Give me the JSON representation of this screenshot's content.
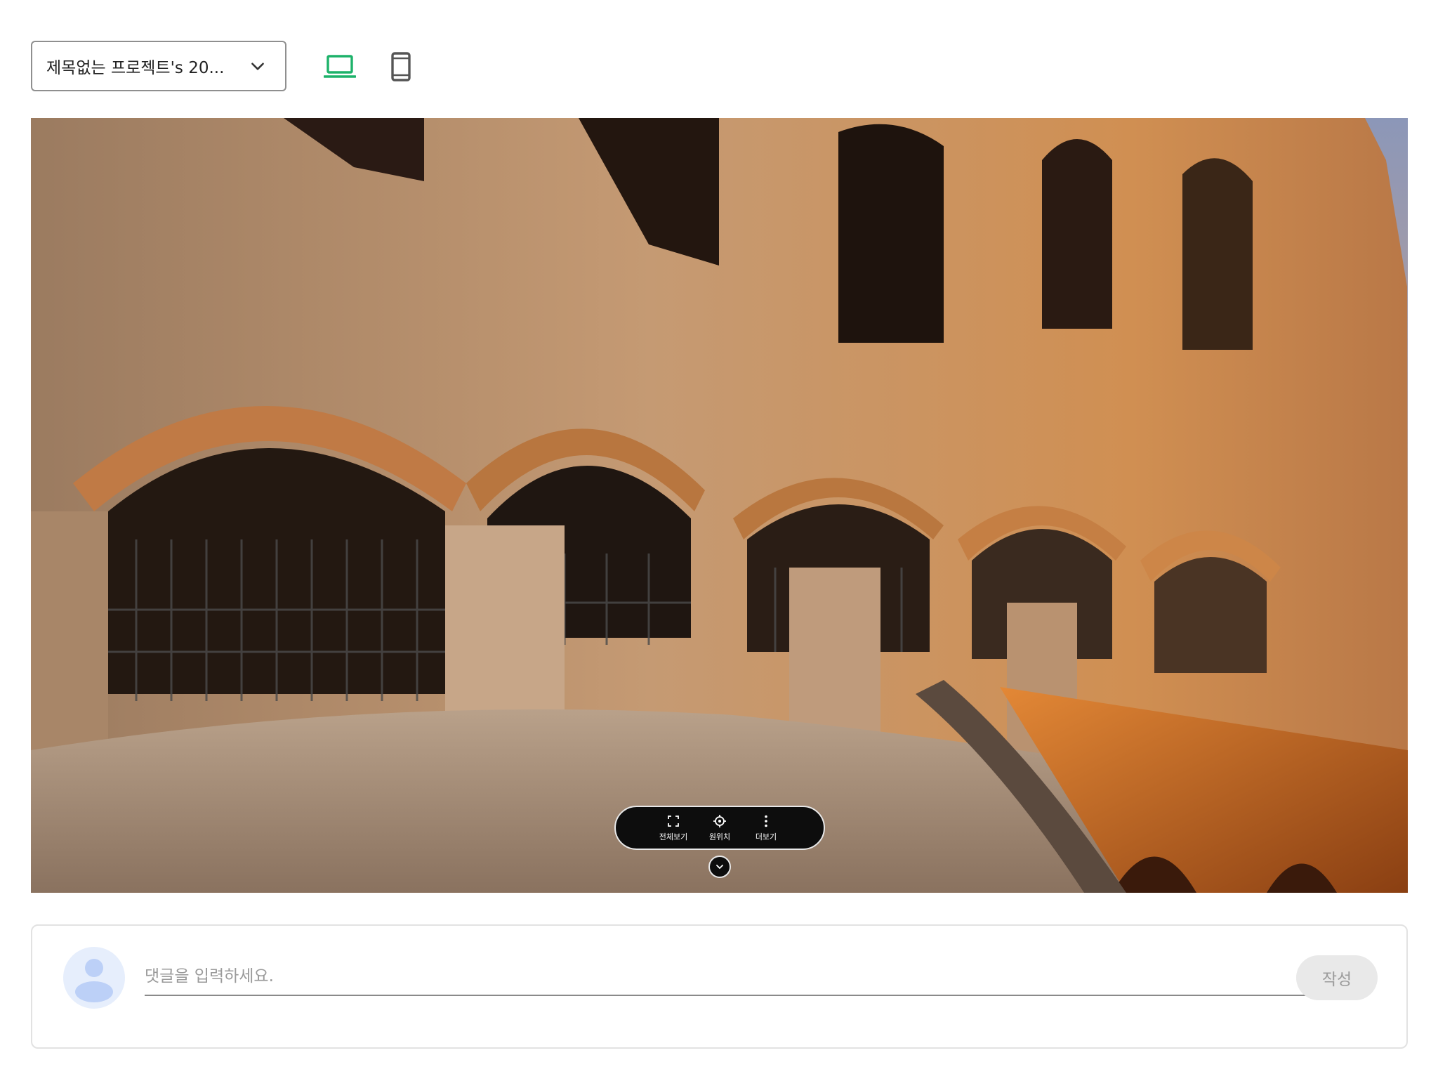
{
  "toolbar": {
    "project_name": "제목없는 프로젝트's 20...",
    "desktop_view_label": "desktop-view",
    "mobile_view_label": "mobile-view"
  },
  "viewer": {
    "controls": {
      "fullscreen_label": "전체보기",
      "origin_label": "원위치",
      "more_label": "더보기"
    }
  },
  "comment": {
    "placeholder": "댓글을 입력하세요.",
    "submit_label": "작성"
  },
  "colors": {
    "accent_green": "#1db26a",
    "icon_gray": "#555555",
    "control_bar_bg": "#0d0d0d",
    "avatar_bg": "#e6eefc",
    "avatar_fg": "#bcd0f7",
    "submit_bg": "#e9e9e9"
  },
  "icons": {
    "dropdown": "chevron-down-icon",
    "desktop": "laptop-icon",
    "mobile": "smartphone-icon",
    "fullscreen": "fullscreen-icon",
    "origin": "crosshair-icon",
    "more": "more-vertical-icon",
    "collapse": "chevron-down-icon",
    "avatar": "user-avatar-icon"
  }
}
